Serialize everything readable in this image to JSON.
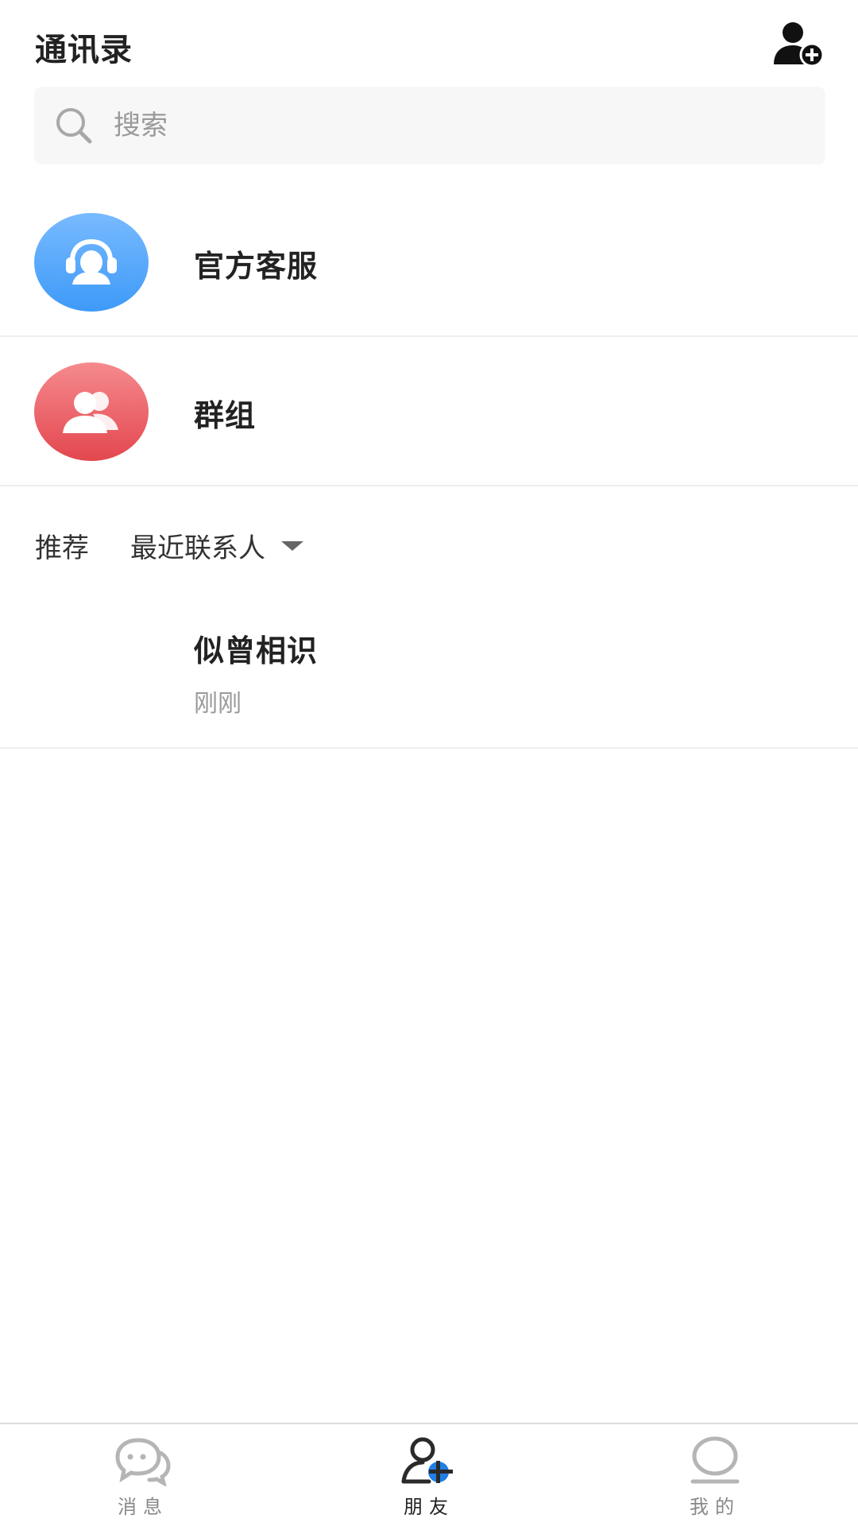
{
  "header": {
    "title": "通讯录"
  },
  "search": {
    "placeholder": "搜索",
    "value": ""
  },
  "entries": [
    {
      "label": "官方客服",
      "icon": "headset-icon",
      "color": "#4aa3fb"
    },
    {
      "label": "群组",
      "icon": "group-icon",
      "color": "#ea5a5f"
    }
  ],
  "filter": {
    "recommend_label": "推荐",
    "recent_label": "最近联系人"
  },
  "contacts": [
    {
      "name": "似曾相识",
      "time": "刚刚"
    }
  ],
  "bottom_nav": {
    "items": [
      {
        "label": "消息",
        "icon": "chat-bubbles-icon",
        "active": false
      },
      {
        "label": "朋友",
        "icon": "friend-add-icon",
        "active": true
      },
      {
        "label": "我的",
        "icon": "profile-icon",
        "active": false
      }
    ]
  },
  "colors": {
    "accent_blue": "#1f7fe6",
    "inactive_gray": "#888888",
    "divider": "#eeeeee"
  }
}
